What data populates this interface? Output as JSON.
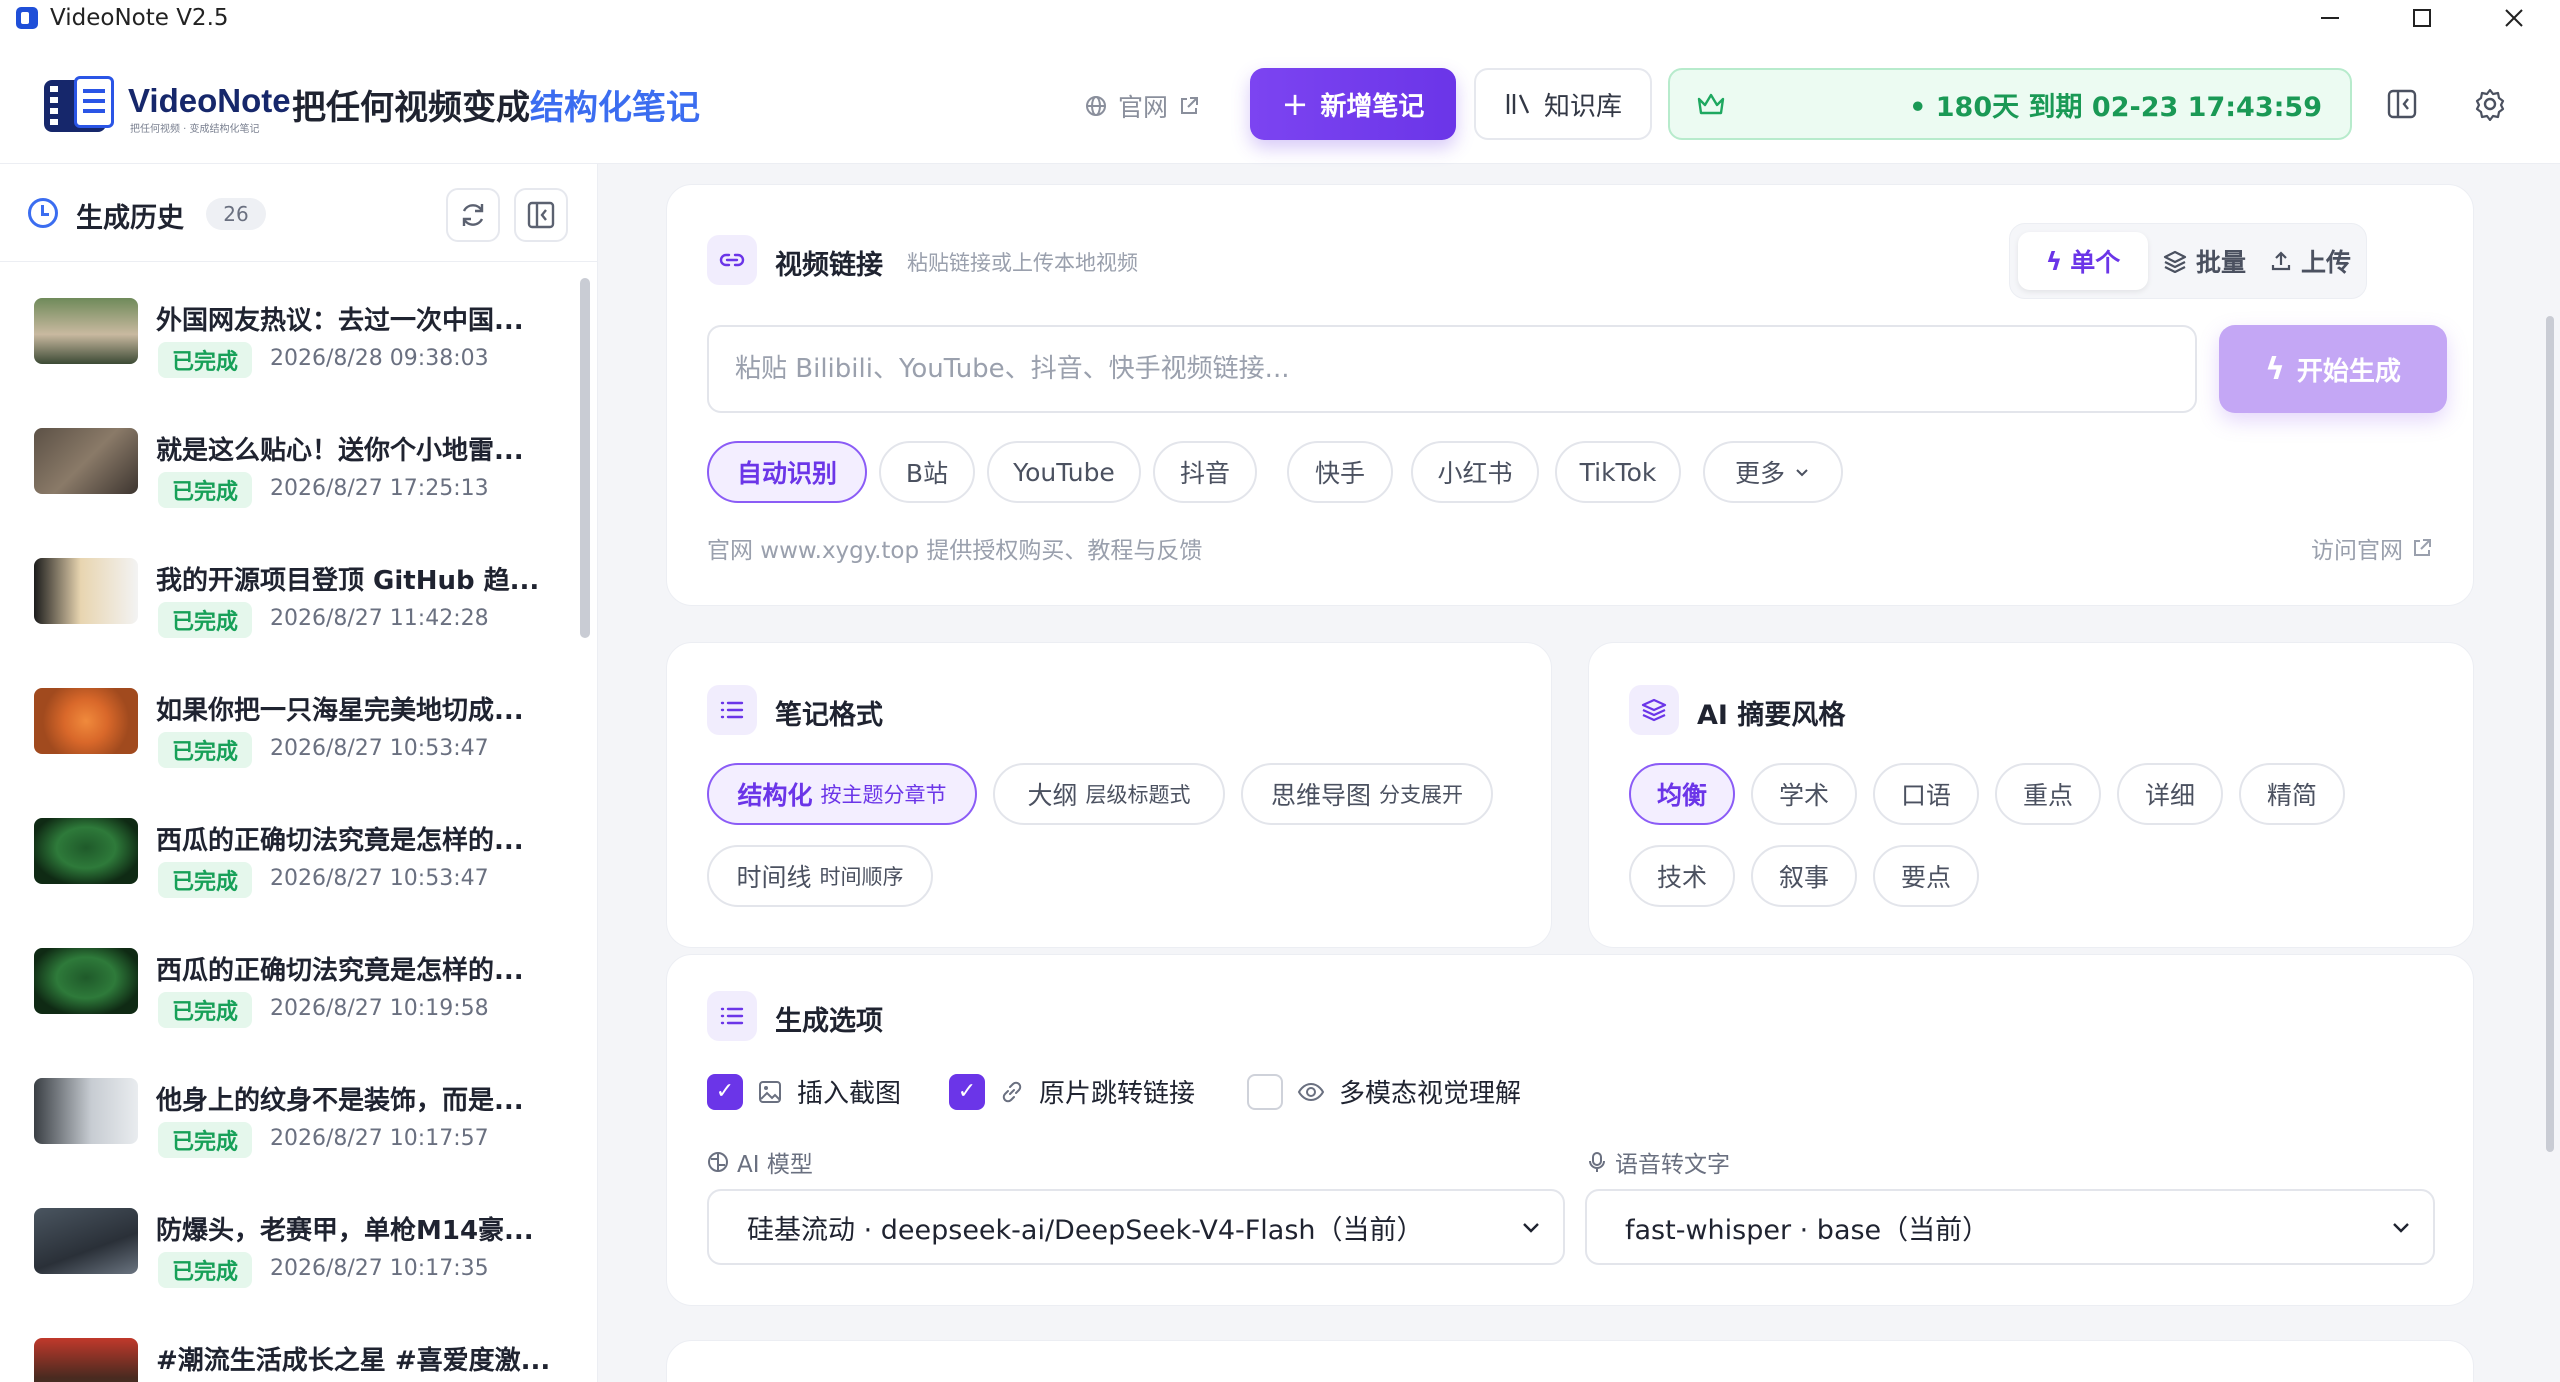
{
  "window": {
    "title": "VideoNote V2.5"
  },
  "header": {
    "logo_text": "VideoNote",
    "logo_sub": "把任何视频 · 变成结构化笔记",
    "slogan_prefix": "把任何视频变成",
    "slogan_highlight": "结构化笔记",
    "official_link": "官网",
    "new_note_button": "新增笔记",
    "knowledge_button": "知识库",
    "vip_status": "• 180天 到期 02-23 17:43:59",
    "accent_color": "#6b35e8"
  },
  "sidebar": {
    "title": "生成历史",
    "count": "26",
    "items": [
      {
        "title": "外国网友热议：去过一次中国...",
        "status": "已完成",
        "time": "2026/8/28 09:38:03"
      },
      {
        "title": "就是这么贴心！送你个小地雷...",
        "status": "已完成",
        "time": "2026/8/27 17:25:13"
      },
      {
        "title": "我的开源项目登顶 GitHub 趋...",
        "status": "已完成",
        "time": "2026/8/27 11:42:28"
      },
      {
        "title": "如果你把一只海星完美地切成...",
        "status": "已完成",
        "time": "2026/8/27 10:53:47"
      },
      {
        "title": "西瓜的正确切法究竟是怎样的...",
        "status": "已完成",
        "time": "2026/8/27 10:53:47"
      },
      {
        "title": "西瓜的正确切法究竟是怎样的...",
        "status": "已完成",
        "time": "2026/8/27 10:19:58"
      },
      {
        "title": "他身上的纹身不是装饰，而是...",
        "status": "已完成",
        "time": "2026/8/27 10:17:57"
      },
      {
        "title": "防爆头，老赛甲，单枪M14豪...",
        "status": "已完成",
        "time": "2026/8/27 10:17:35"
      },
      {
        "title": "#潮流生活成长之星 #喜爱度激...",
        "status": "",
        "time": ""
      }
    ]
  },
  "video_link": {
    "title": "视频链接",
    "subtitle": "粘贴链接或上传本地视频",
    "modes": [
      "单个",
      "批量",
      "上传"
    ],
    "placeholder": "粘贴 Bilibili、YouTube、抖音、快手视频链接...",
    "start_button": "开始生成",
    "platforms": [
      "自动识别",
      "B站",
      "YouTube",
      "抖音",
      "快手",
      "小红书",
      "TikTok",
      "更多"
    ],
    "footer_text": "官网 www.xygy.top 提供授权购买、教程与反馈",
    "footer_link": "访问官网"
  },
  "note_format": {
    "title": "笔记格式",
    "options": [
      {
        "label": "结构化",
        "sub": "按主题分章节"
      },
      {
        "label": "大纲",
        "sub": "层级标题式"
      },
      {
        "label": "思维导图",
        "sub": "分支展开"
      },
      {
        "label": "时间线",
        "sub": "时间顺序"
      }
    ]
  },
  "ai_style": {
    "title": "AI 摘要风格",
    "options": [
      "均衡",
      "学术",
      "口语",
      "重点",
      "详细",
      "精简",
      "技术",
      "叙事",
      "要点"
    ]
  },
  "gen_options": {
    "title": "生成选项",
    "checkboxes": [
      {
        "label": "插入截图",
        "checked": true
      },
      {
        "label": "原片跳转链接",
        "checked": true
      },
      {
        "label": "多模态视觉理解",
        "checked": false
      }
    ],
    "model_label": "AI 模型",
    "model_value": "硅基流动 · deepseek-ai/DeepSeek-V4-Flash（当前）",
    "asr_label": "语音转文字",
    "asr_value": "fast-whisper · base（当前）"
  }
}
